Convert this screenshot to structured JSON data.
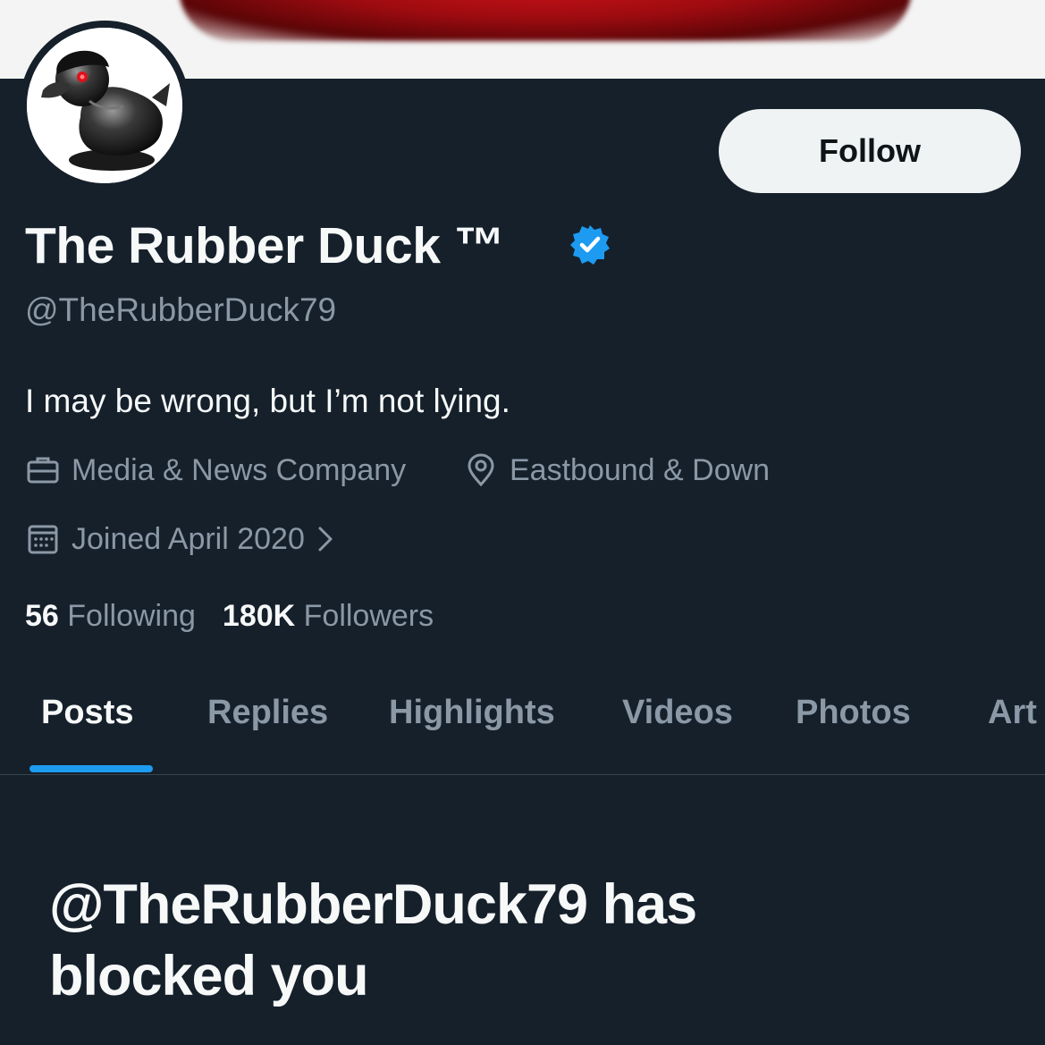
{
  "profile": {
    "name": "The Rubber Duck ™",
    "handle": "@TheRubberDuck79",
    "bio": "I may be wrong, but I’m not lying.",
    "category": "Media & News Company",
    "location": "Eastbound & Down",
    "joined": "Joined April 2020",
    "following_count": "56",
    "following_label": "Following",
    "followers_count": "180K",
    "followers_label": "Followers"
  },
  "actions": {
    "follow_label": "Follow"
  },
  "tabs": [
    {
      "label": "Posts"
    },
    {
      "label": "Replies"
    },
    {
      "label": "Highlights"
    },
    {
      "label": "Videos"
    },
    {
      "label": "Photos"
    },
    {
      "label": "Art"
    }
  ],
  "blocked_message": {
    "line1": "@TheRubberDuck79 has",
    "line2": "blocked you"
  },
  "icons": {
    "verified": "verified-badge-icon",
    "category": "briefcase-icon",
    "location": "location-pin-icon",
    "joined": "calendar-icon",
    "joined_more": "chevron-right-icon"
  },
  "colors": {
    "background": "#15202b",
    "accent": "#1d9bf0",
    "secondary_text": "#8b98a5"
  }
}
